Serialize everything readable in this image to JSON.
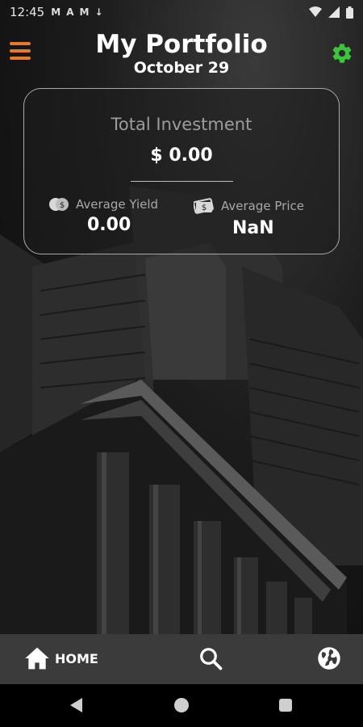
{
  "status_bar": {
    "time": "12:45",
    "notification_icons": [
      "M",
      "A",
      "M",
      "↓"
    ]
  },
  "header": {
    "title": "My Portfolio",
    "date": "October 29"
  },
  "summary": {
    "total_label": "Total Investment",
    "total_value": "$ 0.00",
    "yield_label": "Average Yield",
    "yield_value": "0.00",
    "price_label": "Average Price",
    "price_value": "NaN"
  },
  "bottom_nav": {
    "home_label": "HOME"
  },
  "colors": {
    "accent_orange": "#e8792a",
    "settings_green": "#3cc43c",
    "nav_bg": "#3b3b3b"
  }
}
